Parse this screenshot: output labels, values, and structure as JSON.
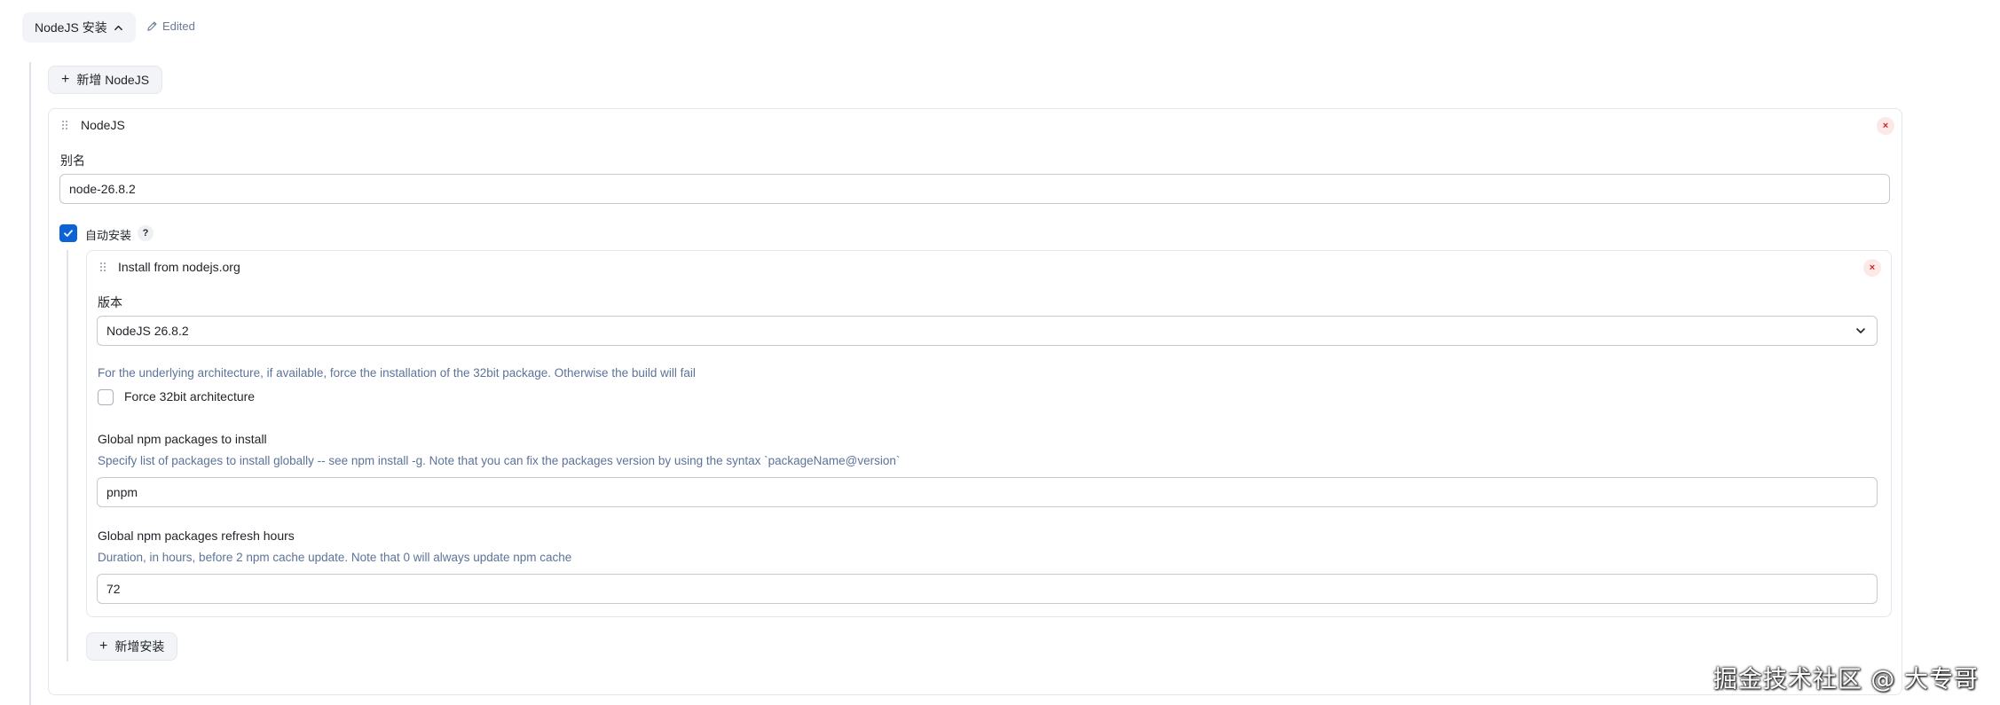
{
  "section": {
    "title": "NodeJS 安装",
    "edited": "Edited"
  },
  "add_nodejs_label": "新增 NodeJS",
  "nodejs_card": {
    "title": "NodeJS",
    "alias_label": "别名",
    "alias_value": "node-26.8.2",
    "auto_install_label": "自动安装",
    "auto_install_checked": true,
    "help_symbol": "?",
    "close_symbol": "×"
  },
  "installer": {
    "title": "Install from nodejs.org",
    "version_label": "版本",
    "version_value": "NodeJS 26.8.2",
    "force32_desc": "For the underlying architecture, if available, force the installation of the 32bit package. Otherwise the build will fail",
    "force32_label": "Force 32bit architecture",
    "force32_checked": false,
    "npm_packages_label": "Global npm packages to install",
    "npm_packages_desc": "Specify list of packages to install globally -- see npm install -g. Note that you can fix the packages version by using the syntax `packageName@version`",
    "npm_packages_value": "pnpm",
    "refresh_label": "Global npm packages refresh hours",
    "refresh_desc": "Duration, in hours, before 2 npm cache update. Note that 0 will always update npm cache",
    "refresh_value": "72",
    "close_symbol": "×"
  },
  "add_installer_label": "新增安装",
  "watermark": "掘金技术社区 @ 大专哥",
  "colors": {
    "accent": "#0b63d6",
    "description": "#5c7399",
    "close_bg": "#fde8e8",
    "close_fg": "#c52828"
  }
}
